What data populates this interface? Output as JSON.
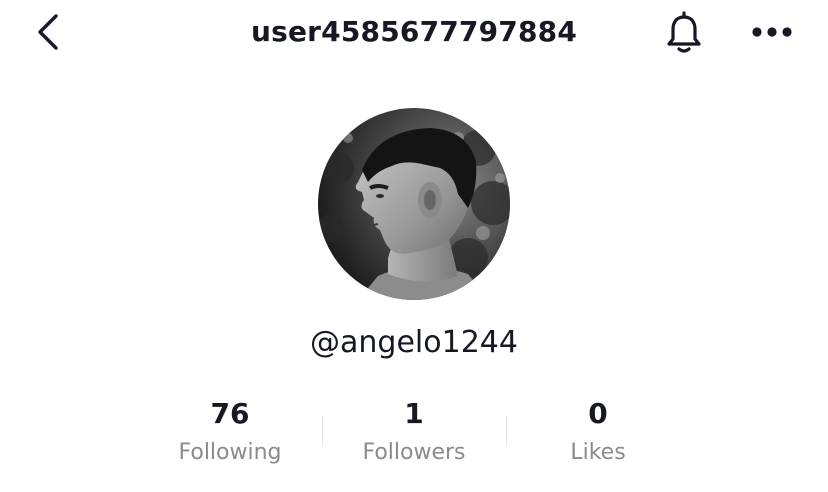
{
  "header": {
    "title": "user4585677797884",
    "back_icon": "chevron-left-icon",
    "bell_icon": "bell-icon",
    "more_icon": "ellipsis-icon"
  },
  "profile": {
    "avatar": "profile-photo",
    "handle": "@angelo1244"
  },
  "stats": [
    {
      "value": "76",
      "label": "Following"
    },
    {
      "value": "1",
      "label": "Followers"
    },
    {
      "value": "0",
      "label": "Likes"
    }
  ],
  "colors": {
    "text_primary": "#161823",
    "text_secondary": "#8a8b91",
    "divider": "#e3e3e4"
  }
}
